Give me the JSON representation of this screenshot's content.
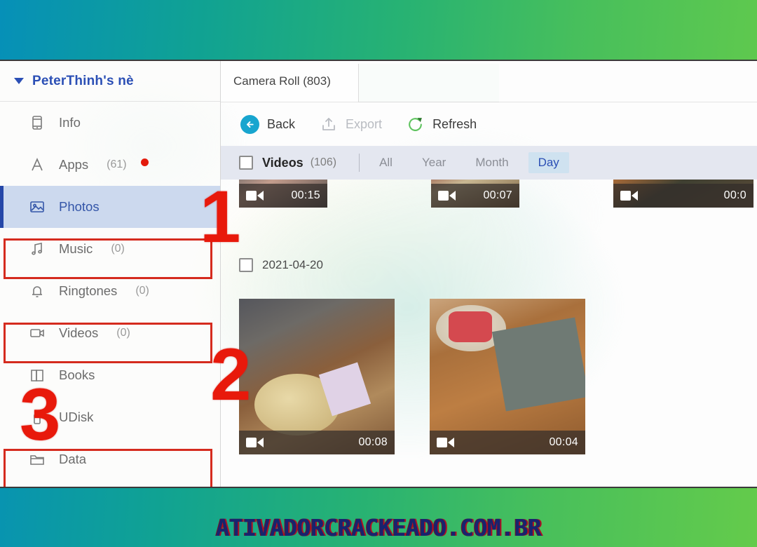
{
  "window": {
    "device_name": "PeterThinh's nè"
  },
  "sidebar": {
    "items": [
      {
        "label": "Info",
        "count": "",
        "icon": "phone-icon",
        "selected": false,
        "badge": false
      },
      {
        "label": "Apps",
        "count": "(61)",
        "icon": "apps-icon",
        "selected": false,
        "badge": true
      },
      {
        "label": "Photos",
        "count": "",
        "icon": "photo-icon",
        "selected": true,
        "badge": false
      },
      {
        "label": "Music",
        "count": "(0)",
        "icon": "music-note-icon",
        "selected": false,
        "badge": false
      },
      {
        "label": "Ringtones",
        "count": "(0)",
        "icon": "bell-icon",
        "selected": false,
        "badge": false
      },
      {
        "label": "Videos",
        "count": "(0)",
        "icon": "video-icon",
        "selected": false,
        "badge": false
      },
      {
        "label": "Books",
        "count": "",
        "icon": "book-icon",
        "selected": false,
        "badge": false
      },
      {
        "label": "UDisk",
        "count": "",
        "icon": "usb-icon",
        "selected": false,
        "badge": false
      },
      {
        "label": "Data",
        "count": "",
        "icon": "folder-icon",
        "selected": false,
        "badge": false
      }
    ]
  },
  "main": {
    "tab": {
      "label": "Camera Roll (803)"
    },
    "toolbar": {
      "back": "Back",
      "export": "Export",
      "refresh": "Refresh"
    },
    "filter": {
      "section_label": "Videos",
      "section_count": "(106)",
      "segments": [
        "All",
        "Year",
        "Month",
        "Day"
      ],
      "selected_segment": "Day"
    },
    "grid": {
      "date_group": "2021-04-20",
      "row_top": [
        {
          "duration": "00:15"
        },
        {
          "duration": "00:07"
        },
        {
          "duration": "00:0"
        }
      ],
      "row_bottom": [
        {
          "duration": "00:08"
        },
        {
          "duration": "00:04"
        }
      ]
    }
  },
  "annotations": {
    "markers": [
      "1",
      "2",
      "3"
    ]
  },
  "footer": {
    "watermark": "ATIVADORCRACKEADO.COM.BR"
  },
  "colors": {
    "accent_blue": "#2b4fb5",
    "annotation_red": "#d52b1e",
    "selected_row": "#ccd9ee",
    "segment_active_bg": "#cfe2f0"
  }
}
